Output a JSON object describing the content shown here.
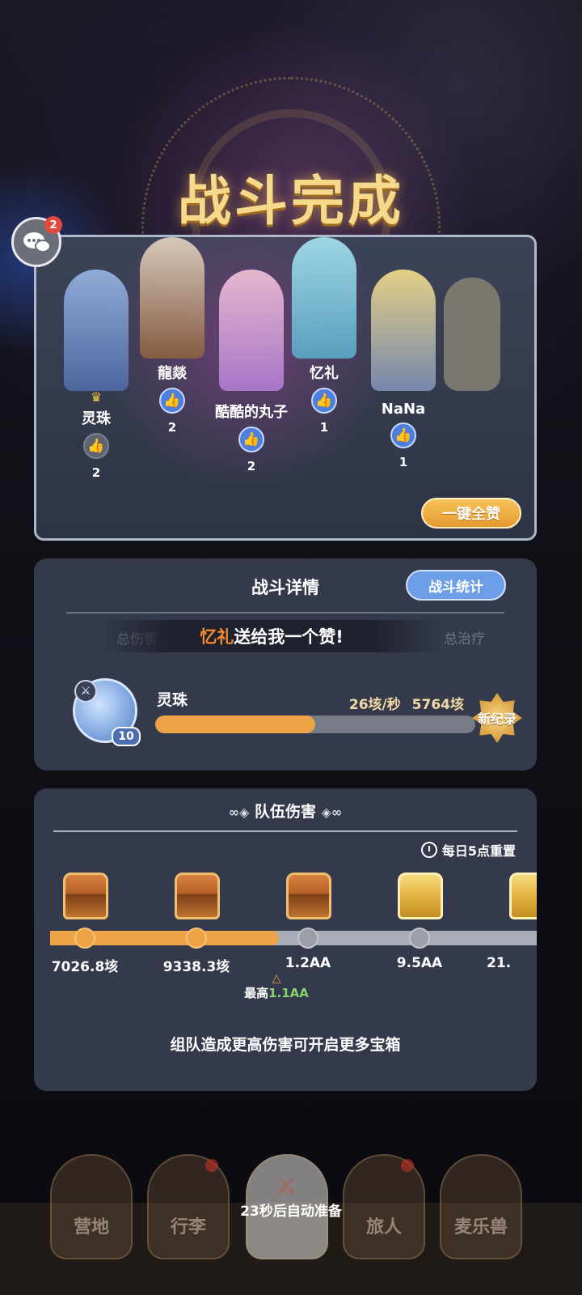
{
  "title": "战斗完成",
  "chat": {
    "badge": "2"
  },
  "party": {
    "members": [
      {
        "name": "灵珠",
        "likes": "2",
        "liked": false,
        "leader": true
      },
      {
        "name": "龍燚",
        "likes": "2",
        "liked": true,
        "leader": false
      },
      {
        "name": "酷酷的丸子",
        "likes": "2",
        "liked": true,
        "leader": false
      },
      {
        "name": "忆礼",
        "likes": "1",
        "liked": true,
        "leader": false
      },
      {
        "name": "NaNa",
        "likes": "1",
        "liked": true,
        "leader": false
      }
    ],
    "like_all_label": "一键全赞"
  },
  "detail": {
    "title": "战斗详情",
    "stats_button": "战斗统计",
    "tabs": [
      "总伤害",
      "总治疗"
    ],
    "toast": {
      "who": "忆礼",
      "message": "送给我一个赞!"
    },
    "player": {
      "name": "灵珠",
      "level": "10",
      "dps": "26垓/秒",
      "total": "5764垓",
      "bar_fill_percent": 50,
      "record_label": "新纪录"
    }
  },
  "team": {
    "title": "队伍伤害",
    "reset_text": "每日5点重置",
    "milestones": [
      "7026.8垓",
      "9338.3垓",
      "1.2AA",
      "9.5AA",
      "21."
    ],
    "progress_fraction": 0.47,
    "peak_label": "最高",
    "peak_value": "1.1AA",
    "hint": "组队造成更高伤害可开启更多宝箱"
  },
  "nav": {
    "items": [
      "营地",
      "行李",
      "",
      "旅人",
      "麦乐兽"
    ],
    "auto_ready": "23秒后自动准备"
  },
  "colors": {
    "accent_orange": "#eea446",
    "like_blue": "#4d7fe0",
    "panel_bg": "#343a4c",
    "title_gold": "#f6d98b",
    "peak_green": "#86d46a"
  }
}
